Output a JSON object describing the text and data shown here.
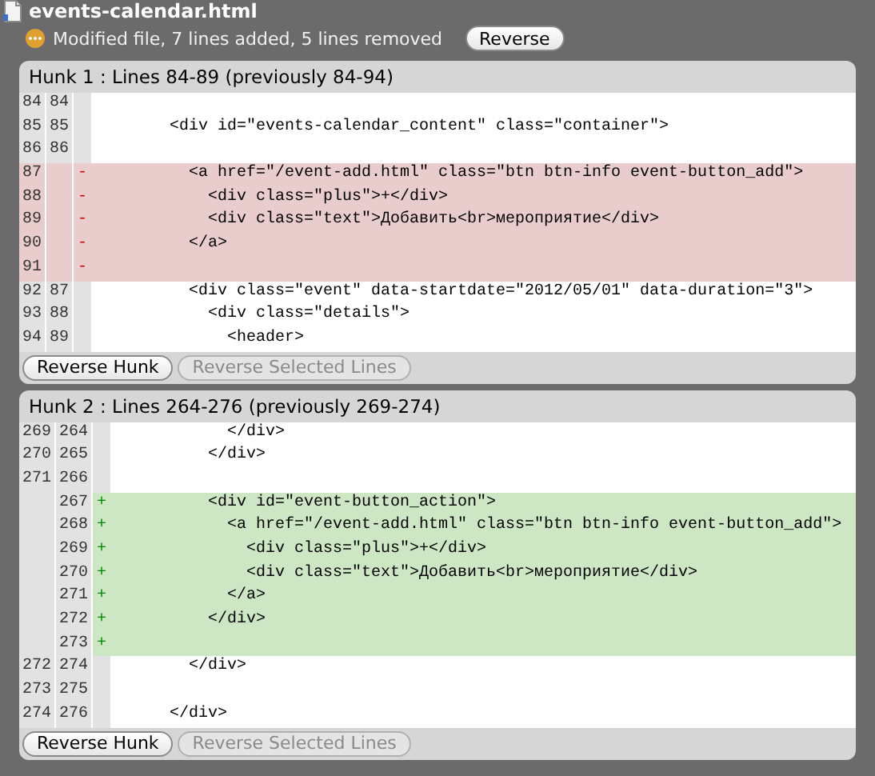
{
  "file": {
    "name": "events-calendar.html",
    "status": "Modified file, 7 lines added, 5 lines removed",
    "reverse_button": "Reverse"
  },
  "hunks": [
    {
      "title": "Hunk 1 : Lines 84-89 (previously 84-94)",
      "lines": [
        {
          "kind": "context",
          "old": "84",
          "new": "84"
        },
        {
          "kind": "context",
          "old": "85",
          "new": "85",
          "code": "        <div id=\"events-calendar_content\" class=\"container\">"
        },
        {
          "kind": "context",
          "old": "86",
          "new": "86"
        },
        {
          "kind": "removed",
          "old": "87",
          "marker": "-",
          "code": "          <a href=\"/event-add.html\" class=\"btn btn-info event-button_add\">"
        },
        {
          "kind": "removed",
          "old": "88",
          "marker": "-",
          "code": "            <div class=\"plus\">+</div>"
        },
        {
          "kind": "removed",
          "old": "89",
          "marker": "-",
          "code": "            <div class=\"text\">Добавить<br>мероприятие</div>"
        },
        {
          "kind": "removed",
          "old": "90",
          "marker": "-",
          "code": "          </a>"
        },
        {
          "kind": "removed",
          "old": "91",
          "marker": "-"
        },
        {
          "kind": "context",
          "old": "92",
          "new": "87",
          "code": "          <div class=\"event\" data-startdate=\"2012/05/01\" data-duration=\"3\">"
        },
        {
          "kind": "context",
          "old": "93",
          "new": "88",
          "code": "            <div class=\"details\">"
        },
        {
          "kind": "context",
          "old": "94",
          "new": "89",
          "code": "              <header>"
        }
      ],
      "buttons": [
        {
          "label": "Reverse Hunk",
          "disabled": false
        },
        {
          "label": "Reverse Selected Lines",
          "disabled": true
        }
      ]
    },
    {
      "title": "Hunk 2 : Lines 264-276 (previously 269-274)",
      "lines": [
        {
          "kind": "context",
          "old": "269",
          "new": "264",
          "code": "            </div>"
        },
        {
          "kind": "context",
          "old": "270",
          "new": "265",
          "code": "          </div>"
        },
        {
          "kind": "context",
          "old": "271",
          "new": "266"
        },
        {
          "kind": "added",
          "new": "267",
          "marker": "+",
          "code": "          <div id=\"event-button_action\">"
        },
        {
          "kind": "added",
          "new": "268",
          "marker": "+",
          "code": "            <a href=\"/event-add.html\" class=\"btn btn-info event-button_add\">"
        },
        {
          "kind": "added",
          "new": "269",
          "marker": "+",
          "code": "              <div class=\"plus\">+</div>"
        },
        {
          "kind": "added",
          "new": "270",
          "marker": "+",
          "code": "              <div class=\"text\">Добавить<br>мероприятие</div>"
        },
        {
          "kind": "added",
          "new": "271",
          "marker": "+",
          "code": "            </a>"
        },
        {
          "kind": "added",
          "new": "272",
          "marker": "+",
          "code": "          </div>"
        },
        {
          "kind": "added",
          "new": "273",
          "marker": "+"
        },
        {
          "kind": "context",
          "old": "272",
          "new": "274",
          "code": "        </div>"
        },
        {
          "kind": "context",
          "old": "273",
          "new": "275"
        },
        {
          "kind": "context",
          "old": "274",
          "new": "276",
          "code": "      </div>"
        }
      ],
      "buttons": [
        {
          "label": "Reverse Hunk",
          "disabled": false
        },
        {
          "label": "Reverse Selected Lines",
          "disabled": true
        }
      ]
    }
  ]
}
